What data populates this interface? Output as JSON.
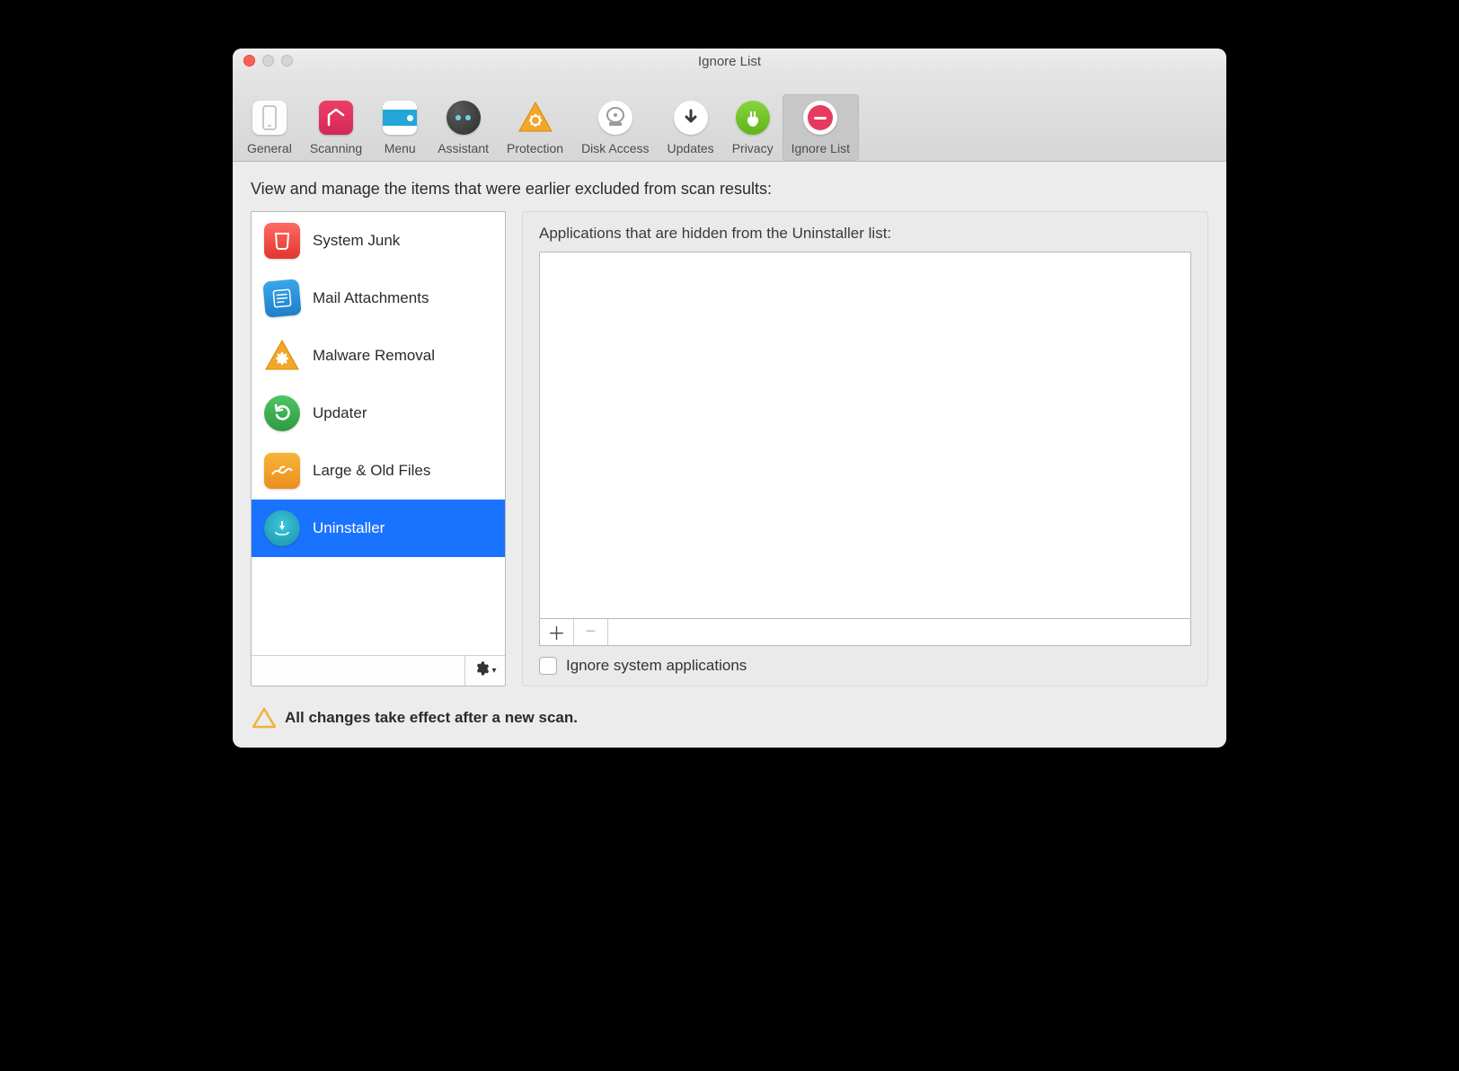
{
  "window": {
    "title": "Ignore List"
  },
  "toolbar": {
    "items": [
      {
        "label": "General"
      },
      {
        "label": "Scanning"
      },
      {
        "label": "Menu"
      },
      {
        "label": "Assistant"
      },
      {
        "label": "Protection"
      },
      {
        "label": "Disk Access"
      },
      {
        "label": "Updates"
      },
      {
        "label": "Privacy"
      },
      {
        "label": "Ignore List"
      }
    ],
    "active_index": 8
  },
  "main": {
    "heading": "View and manage the items that were earlier excluded from scan results:",
    "sidebar": {
      "items": [
        {
          "label": "System Junk"
        },
        {
          "label": "Mail Attachments"
        },
        {
          "label": "Malware Removal"
        },
        {
          "label": "Updater"
        },
        {
          "label": "Large & Old Files"
        },
        {
          "label": "Uninstaller"
        }
      ],
      "selected_index": 5
    },
    "right": {
      "subhead": "Applications that are hidden from the Uninstaller list:",
      "checkbox_label": "Ignore system applications",
      "checkbox_checked": false
    },
    "footer_note": "All changes take effect after a new scan."
  }
}
